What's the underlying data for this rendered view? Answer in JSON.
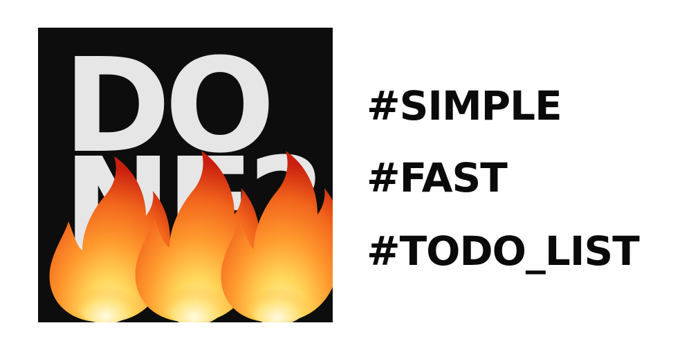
{
  "logo": {
    "line1": "DO",
    "line2": "NE?",
    "text_color": "#e6e6e6",
    "background_color": "#0d0d0d",
    "decoration_icon": "fire-icon",
    "flame_colors": [
      "#c91f0f",
      "#f2651c",
      "#ff9a2e",
      "#ffe27a"
    ]
  },
  "hashtags": [
    "#SIMPLE",
    "#FAST",
    "#TODO_LIST"
  ],
  "hashtag_color": "#0a0a0a"
}
